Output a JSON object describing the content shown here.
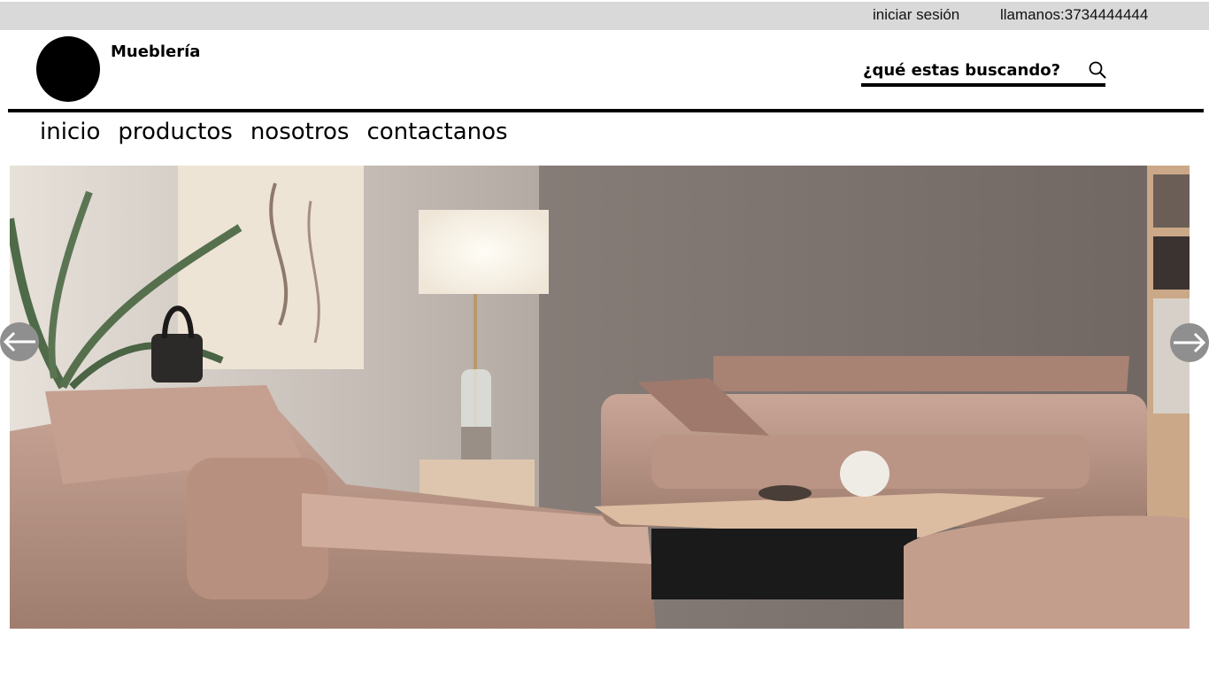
{
  "topbar": {
    "login_label": "iniciar sesión",
    "phone_text": "llamanos:3734444444"
  },
  "header": {
    "brand_name": "Mueblería",
    "search": {
      "placeholder": "¿qué estas buscando?",
      "value": ""
    }
  },
  "nav": {
    "items": [
      {
        "label": "inicio"
      },
      {
        "label": "productos"
      },
      {
        "label": "nosotros"
      },
      {
        "label": "contactanos"
      }
    ]
  },
  "carousel": {
    "prev_icon": "arrow-left-icon",
    "next_icon": "arrow-right-icon"
  },
  "colors": {
    "topbar_bg": "#d9d9d9",
    "arrow_bg": "#8f8f8f",
    "wall": "#7d726d",
    "sofa": "#b08f80"
  }
}
